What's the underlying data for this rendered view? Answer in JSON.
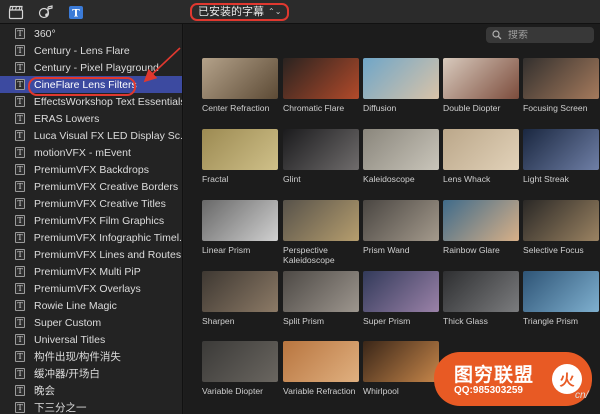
{
  "toolbar": {
    "library": "已安装的字幕",
    "icons": [
      "clapperboard-icon",
      "photos-music-icon",
      "titles-icon"
    ]
  },
  "sidebar": {
    "items": [
      {
        "label": "360°"
      },
      {
        "label": "Century - Lens Flare"
      },
      {
        "label": "Century - Pixel Playground"
      },
      {
        "label": "CineFlare Lens Filters",
        "selected": true
      },
      {
        "label": "EffectsWorkshop Text Essentials"
      },
      {
        "label": "ERAS Lowers"
      },
      {
        "label": "Luca Visual FX LED Display Sc..."
      },
      {
        "label": "motionVFX - mEvent"
      },
      {
        "label": "PremiumVFX Backdrops"
      },
      {
        "label": "PremiumVFX Creative Borders"
      },
      {
        "label": "PremiumVFX Creative Titles"
      },
      {
        "label": "PremiumVFX Film Graphics"
      },
      {
        "label": "PremiumVFX Infographic Timel..."
      },
      {
        "label": "PremiumVFX Lines and Routes"
      },
      {
        "label": "PremiumVFX Multi PiP"
      },
      {
        "label": "PremiumVFX Overlays"
      },
      {
        "label": "Rowie Line Magic"
      },
      {
        "label": "Super Custom"
      },
      {
        "label": "Universal Titles"
      },
      {
        "label": "构件出现/构件消失"
      },
      {
        "label": "缓冲器/开场白"
      },
      {
        "label": "晚会"
      },
      {
        "label": "下三分之一"
      }
    ]
  },
  "search": {
    "placeholder": "搜索"
  },
  "tiles": [
    {
      "label": "Center Refraction",
      "colors": [
        "#b4a28a",
        "#5c4a35"
      ]
    },
    {
      "label": "Chromatic Flare",
      "colors": [
        "#2a2320",
        "#b24a2a"
      ]
    },
    {
      "label": "Diffusion",
      "colors": [
        "#6fa6c8",
        "#d9c3a8"
      ]
    },
    {
      "label": "Double Diopter",
      "colors": [
        "#d8cabd",
        "#7c4c3c"
      ]
    },
    {
      "label": "Focusing Screen",
      "colors": [
        "#33302e",
        "#a57a5c"
      ]
    },
    {
      "label": "Fractal",
      "colors": [
        "#9c8a52",
        "#cfc089"
      ]
    },
    {
      "label": "Glint",
      "colors": [
        "#1b1b1d",
        "#6f6c6c"
      ]
    },
    {
      "label": "Kaleidoscope",
      "colors": [
        "#8a867c",
        "#c9c5ba"
      ]
    },
    {
      "label": "Lens Whack",
      "colors": [
        "#bba78a",
        "#e2d2b9"
      ]
    },
    {
      "label": "Light Streak",
      "colors": [
        "#1a2740",
        "#6f7fa6"
      ]
    },
    {
      "label": "Linear Prism",
      "colors": [
        "#686868",
        "#d0d0d0"
      ]
    },
    {
      "label": "Perspective Kaleidoscope",
      "colors": [
        "#57524a",
        "#b69e6e"
      ]
    },
    {
      "label": "Prism Wand",
      "colors": [
        "#4a4642",
        "#a49a8c"
      ]
    },
    {
      "label": "Rainbow Glare",
      "colors": [
        "#3f6b8a",
        "#d8b088"
      ]
    },
    {
      "label": "Selective Focus",
      "colors": [
        "#2a2826",
        "#9b8362"
      ]
    },
    {
      "label": "Sharpen",
      "colors": [
        "#3e3832",
        "#8c7a66"
      ]
    },
    {
      "label": "Split Prism",
      "colors": [
        "#4d4945",
        "#9d968e"
      ]
    },
    {
      "label": "Super Prism",
      "colors": [
        "#323a5a",
        "#9b82a8"
      ]
    },
    {
      "label": "Thick Glass",
      "colors": [
        "#2e2f31",
        "#7b7c7e"
      ]
    },
    {
      "label": "Triangle Prism",
      "colors": [
        "#2e5476",
        "#7fb0cf"
      ]
    },
    {
      "label": "Variable Diopter",
      "colors": [
        "#3b3a38",
        "#6a6660"
      ]
    },
    {
      "label": "Variable Refraction",
      "colors": [
        "#b8753f",
        "#e0b080"
      ]
    },
    {
      "label": "Whirlpool",
      "colors": [
        "#3a2618",
        "#c6864a"
      ]
    }
  ],
  "watermark": {
    "title": "图穷联盟",
    "qq": "QQ:985303259",
    "logo": "火",
    "url": "cn/"
  },
  "accent": "#e0382f",
  "selection_color": "#3c4aa0"
}
